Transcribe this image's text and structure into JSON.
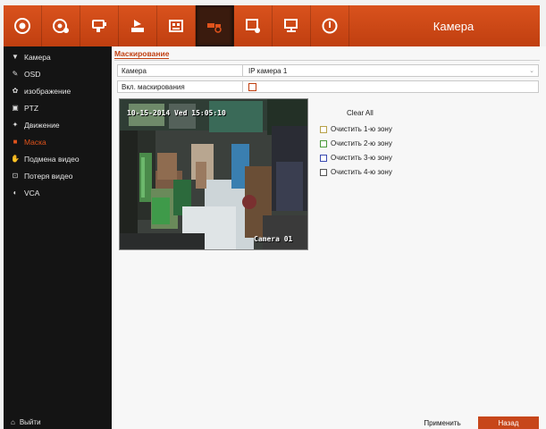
{
  "toolbar": {
    "title": "Камера",
    "buttons": [
      {
        "icon": "live-view-icon"
      },
      {
        "icon": "playback-icon"
      },
      {
        "icon": "ptz-icon"
      },
      {
        "icon": "export-icon"
      },
      {
        "icon": "hdd-icon"
      },
      {
        "icon": "record-icon",
        "active": true
      },
      {
        "icon": "camera-settings-icon"
      },
      {
        "icon": "network-icon"
      },
      {
        "icon": "shutdown-icon"
      }
    ],
    "accent": "#c8471a"
  },
  "sidebar": {
    "items": [
      {
        "label": "Камера",
        "icon": "camera-icon",
        "glyph": "▼"
      },
      {
        "label": "OSD",
        "icon": "osd-icon",
        "glyph": "✎"
      },
      {
        "label": "изображение",
        "icon": "image-icon",
        "glyph": "✿"
      },
      {
        "label": "PTZ",
        "icon": "ptz-icon",
        "glyph": "▣"
      },
      {
        "label": "Движение",
        "icon": "motion-icon",
        "glyph": "✦"
      },
      {
        "label": "Маска",
        "icon": "mask-icon",
        "glyph": "■",
        "active": true
      },
      {
        "label": "Подмена видео",
        "icon": "tamper-icon",
        "glyph": "✋"
      },
      {
        "label": "Потеря видео",
        "icon": "video-loss-icon",
        "glyph": "⊡"
      },
      {
        "label": "VCA",
        "icon": "vca-icon",
        "glyph": "◐"
      }
    ],
    "exit_label": "Выйти"
  },
  "main": {
    "section_title": "Маскирование",
    "camera_label": "Камера",
    "camera_value": "IP камера 1",
    "enable_label": "Вкл. маскирования",
    "enable_checked": false,
    "preview": {
      "timestamp": "10-15-2014 Ved 15:05:10",
      "camera_name": "Camera 01"
    },
    "clear_all_label": "Clear All",
    "zones": [
      {
        "label": "Очистить 1-ю зону",
        "color": "#b8a24a"
      },
      {
        "label": "Очистить 2-ю зону",
        "color": "#4a9a3a"
      },
      {
        "label": "Очистить 3-ю зону",
        "color": "#3a4ab0"
      },
      {
        "label": "Очистить 4-ю зону",
        "color": "#555555"
      }
    ]
  },
  "footer": {
    "apply_label": "Применить",
    "back_label": "Назад"
  }
}
